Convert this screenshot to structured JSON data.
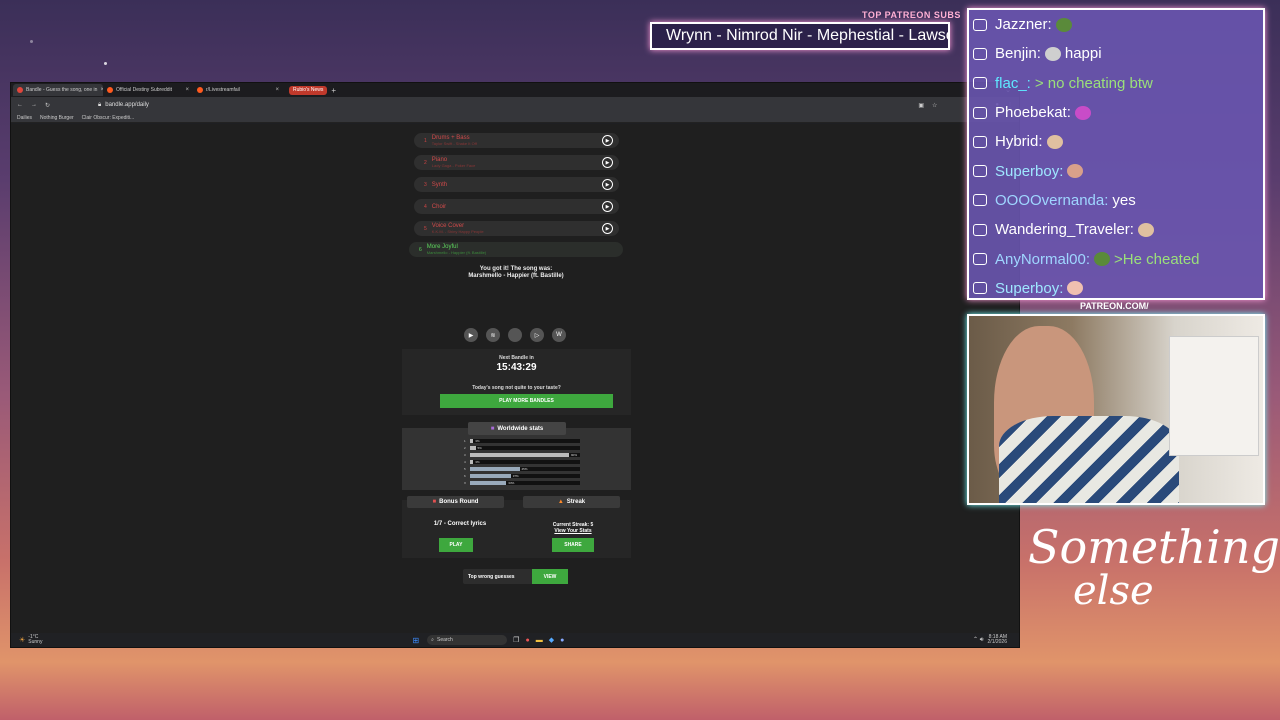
{
  "stream": {
    "subs_label": "TOP PATREON SUBS",
    "subs_ticker": "Wrynn - Nimrod Nir - Mephestial - Lawson",
    "patreon_url": "PATREON.COM/",
    "logo_line1": "Something",
    "logo_line2": "else",
    "colors": {
      "chat_bg": "#6955af",
      "neon_pink": "#ff9bd8",
      "neon_cyan": "#77ffff"
    }
  },
  "browser": {
    "tabs": [
      {
        "label": "Bandle - Guess the song, one in",
        "icon": "bandle-icon"
      },
      {
        "label": "Official Destiny Subreddit",
        "icon": "reddit-icon"
      },
      {
        "label": "r/Livestreamfail",
        "icon": "reddit-icon"
      }
    ],
    "extra_tab": "Rubio's News",
    "url": "bandle.app/daily",
    "bookmarks": [
      "Dailies",
      "Nothing Burger",
      "Clair Obscur: Expediti..."
    ]
  },
  "bandle": {
    "clips": [
      {
        "num": "1",
        "name": "Drums + Bass",
        "sub": "Taylor Swift - Shake It Off",
        "state": "wrong"
      },
      {
        "num": "2",
        "name": "Piano",
        "sub": "Lady Gaga - Poker Face",
        "state": "wrong"
      },
      {
        "num": "3",
        "name": "Synth",
        "sub": "",
        "state": "wrong"
      },
      {
        "num": "4",
        "name": "Choir",
        "sub": "",
        "state": "wrong"
      },
      {
        "num": "5",
        "name": "Voice Cover",
        "sub": "K.K.M. - Shiny Happy People",
        "state": "wrong"
      },
      {
        "num": "6",
        "name": "More Joyful",
        "sub": "Marshmello - Happier (ft. Bastille)",
        "state": "correct"
      }
    ],
    "got_it": "You got it! The song was:",
    "song": "Marshmello - Happier (ft. Bastille)",
    "link_icons": [
      "youtube-icon",
      "spotify-icon",
      "apple-music-icon",
      "play-icon",
      "wikipedia-icon"
    ],
    "link_glyphs": [
      "▶",
      "≋",
      "",
      "▷",
      "W"
    ],
    "next_label": "Next Bandle in",
    "timer": "15:43:29",
    "taste_text": "Today's song not quite to your taste?",
    "play_more": "PLAY MORE BANDLES",
    "stats_title": "Worldwide stats",
    "stats": [
      {
        "label": "1",
        "pct_value": 3,
        "pct": "3%"
      },
      {
        "label": "2",
        "pct_value": 5,
        "pct": "5%"
      },
      {
        "label": "3",
        "pct_value": 90,
        "pct": "90%"
      },
      {
        "label": "4",
        "pct_value": 3,
        "pct": "3%"
      },
      {
        "label": "5",
        "pct_value": 45,
        "pct": "45%"
      },
      {
        "label": "6",
        "pct_value": 37,
        "pct": "37%"
      },
      {
        "label": "X",
        "pct_value": 33,
        "pct": "33%"
      }
    ],
    "bonus_title": "Bonus Round",
    "bonus_text": "1/7 - Correct lyrics",
    "bonus_button": "PLAY",
    "streak_title": "Streak",
    "streak_text": "Current Streak: 5",
    "streak_link": "View Your Stats",
    "streak_button": "SHARE",
    "wrong_label": "Top wrong guesses",
    "wrong_button": "VIEW"
  },
  "taskbar": {
    "weather": "-1°C",
    "weather_sub": "Sunny",
    "search": "Search",
    "time": "8:18 AM",
    "date": "2/1/2026"
  },
  "chat": [
    {
      "user": "Jazzner:",
      "text": "",
      "color": "#ffffff",
      "emote": "#5a8a3a"
    },
    {
      "user": "Benjin:",
      "text": "happi",
      "color": "#ffffff",
      "emote": "#cfcfcf"
    },
    {
      "user": "flac_:",
      "text": "> no cheating btw",
      "color": "#5fe8ff",
      "text_color": "#9be07a"
    },
    {
      "user": "Phoebekat:",
      "text": "",
      "color": "#ffffff",
      "emote": "#c84cc8"
    },
    {
      "user": "Hybrid:",
      "text": "",
      "color": "#ffffff",
      "emote": "#e0c0a0"
    },
    {
      "user": "Superboy:",
      "text": "",
      "color": "#9fe7ff",
      "emote": "#d9a08a"
    },
    {
      "user": "OOOOvernanda:",
      "text": "yes",
      "color": "#9fd6ff"
    },
    {
      "user": "Wandering_Traveler:",
      "text": "",
      "color": "#ffffff",
      "emote": "#e0c0a0"
    },
    {
      "user": "AnyNormal00:",
      "text": ">He cheated",
      "color": "#9fd6ff",
      "text_color": "#9be07a",
      "emote": "#5a8a3a"
    },
    {
      "user": "Superboy:",
      "text": "",
      "color": "#9fe7ff",
      "emote": "#f0c0b0"
    }
  ]
}
